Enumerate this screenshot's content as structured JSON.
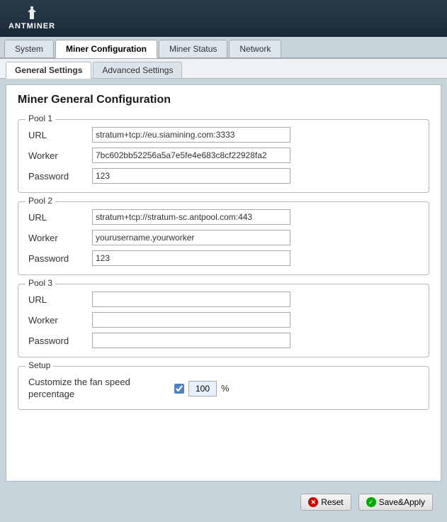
{
  "header": {
    "logo_text": "ANTMINER"
  },
  "nav": {
    "tabs": [
      {
        "label": "System",
        "active": false
      },
      {
        "label": "Miner Configuration",
        "active": true
      },
      {
        "label": "Miner Status",
        "active": false
      },
      {
        "label": "Network",
        "active": false
      }
    ]
  },
  "sub_nav": {
    "tabs": [
      {
        "label": "General Settings",
        "active": true
      },
      {
        "label": "Advanced Settings",
        "active": false
      }
    ]
  },
  "page_title": "Miner General Configuration",
  "pool1": {
    "legend": "Pool 1",
    "url_label": "URL",
    "url_value": "stratum+tcp://eu.siamining.com:3333",
    "worker_label": "Worker",
    "worker_value": "7bc602bb52256a5a7e5fe4e683c8cf22928fa2",
    "password_label": "Password",
    "password_value": "123"
  },
  "pool2": {
    "legend": "Pool 2",
    "url_label": "URL",
    "url_value": "stratum+tcp://stratum-sc.antpool.com:443",
    "worker_label": "Worker",
    "worker_value": "yourusername.yourworker",
    "password_label": "Password",
    "password_value": "123"
  },
  "pool3": {
    "legend": "Pool 3",
    "url_label": "URL",
    "url_value": "",
    "worker_label": "Worker",
    "worker_value": "",
    "password_label": "Password",
    "password_value": ""
  },
  "setup": {
    "legend": "Setup",
    "fan_label": "Customize the fan speed percentage",
    "fan_value": "100",
    "fan_percent": "%"
  },
  "footer": {
    "reset_label": "Reset",
    "save_label": "Save&Apply"
  }
}
